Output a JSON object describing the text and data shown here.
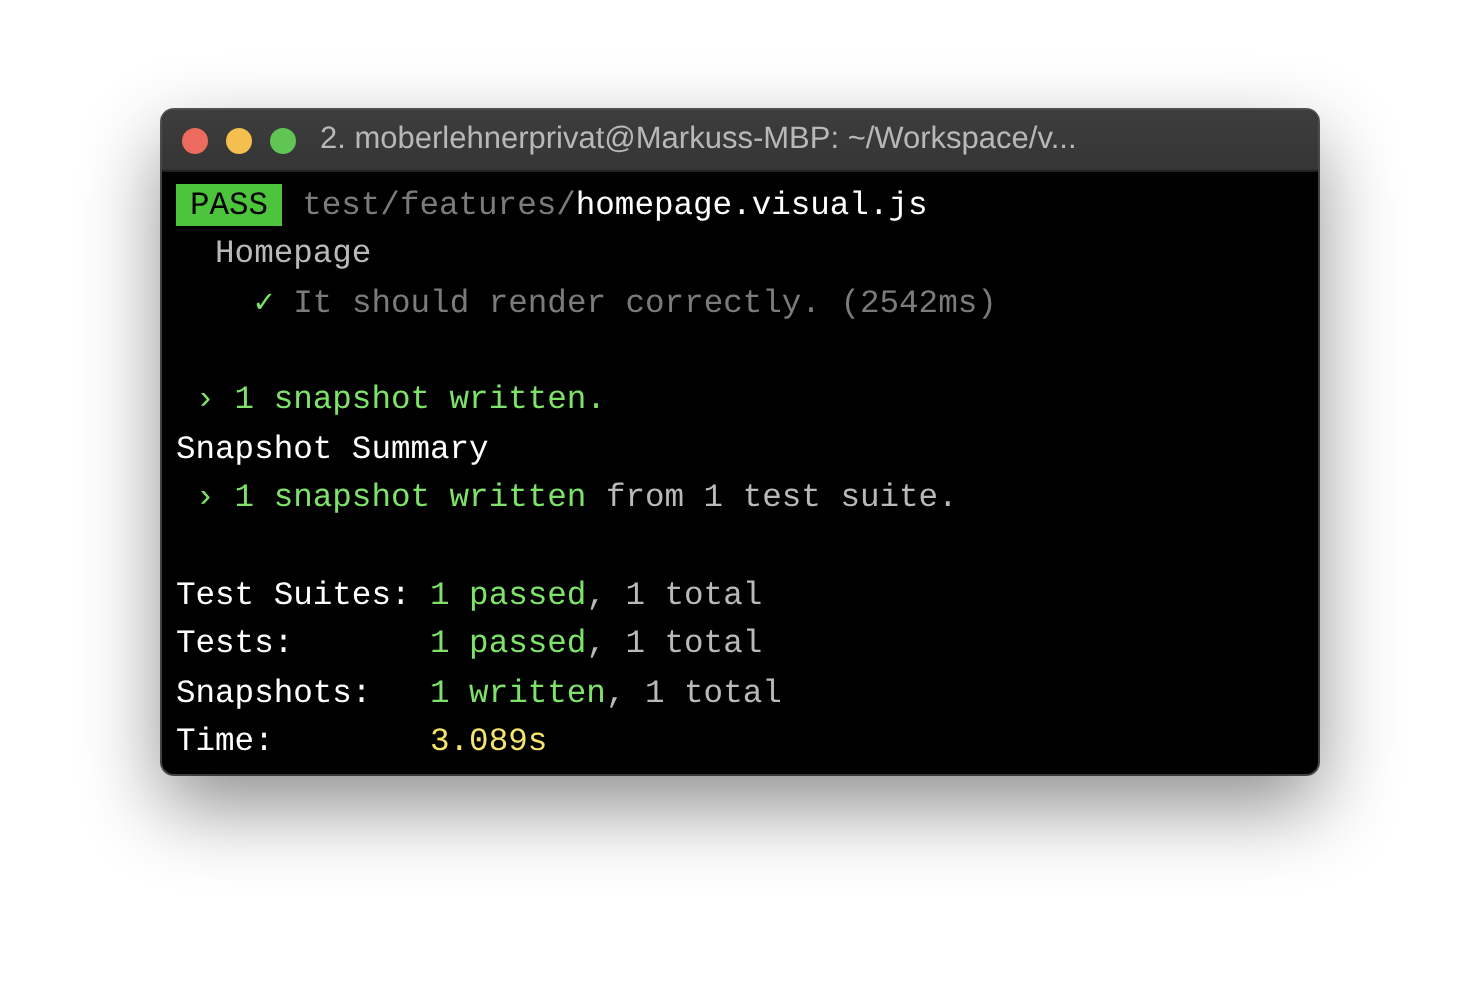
{
  "window": {
    "title": "2. moberlehnerprivat@Markuss-MBP: ~/Workspace/v..."
  },
  "lines": [
    {
      "kind": "result",
      "badge": "PASS",
      "segments": [
        {
          "kind": "dim",
          "text": "test/features/"
        },
        {
          "kind": "bright",
          "text": "homepage.visual.js"
        }
      ]
    },
    {
      "kind": "text",
      "segments": [
        {
          "kind": "plain",
          "text": "  Homepage"
        }
      ]
    },
    {
      "kind": "text",
      "segments": [
        {
          "kind": "green",
          "text": "    ✓ "
        },
        {
          "kind": "dim",
          "text": "It should render correctly. (2542ms)"
        }
      ]
    },
    {
      "kind": "blank"
    },
    {
      "kind": "text",
      "segments": [
        {
          "kind": "green",
          "text": " › 1 snapshot written."
        }
      ]
    },
    {
      "kind": "text",
      "segments": [
        {
          "kind": "bright",
          "text": "Snapshot Summary"
        }
      ]
    },
    {
      "kind": "text",
      "segments": [
        {
          "kind": "green",
          "text": " › 1 snapshot written"
        },
        {
          "kind": "plain",
          "text": " from 1 test suite."
        }
      ]
    },
    {
      "kind": "blank"
    },
    {
      "kind": "text",
      "segments": [
        {
          "kind": "bright",
          "text": "Test Suites: "
        },
        {
          "kind": "green",
          "text": "1 passed"
        },
        {
          "kind": "plain",
          "text": ", 1 total"
        }
      ]
    },
    {
      "kind": "text",
      "segments": [
        {
          "kind": "bright",
          "text": "Tests:       "
        },
        {
          "kind": "green",
          "text": "1 passed"
        },
        {
          "kind": "plain",
          "text": ", 1 total"
        }
      ]
    },
    {
      "kind": "text",
      "segments": [
        {
          "kind": "bright",
          "text": "Snapshots:   "
        },
        {
          "kind": "green",
          "text": "1 written"
        },
        {
          "kind": "plain",
          "text": ", 1 total"
        }
      ]
    },
    {
      "kind": "text",
      "segments": [
        {
          "kind": "bright",
          "text": "Time:        "
        },
        {
          "kind": "yellow",
          "text": "3.089s"
        }
      ]
    }
  ]
}
